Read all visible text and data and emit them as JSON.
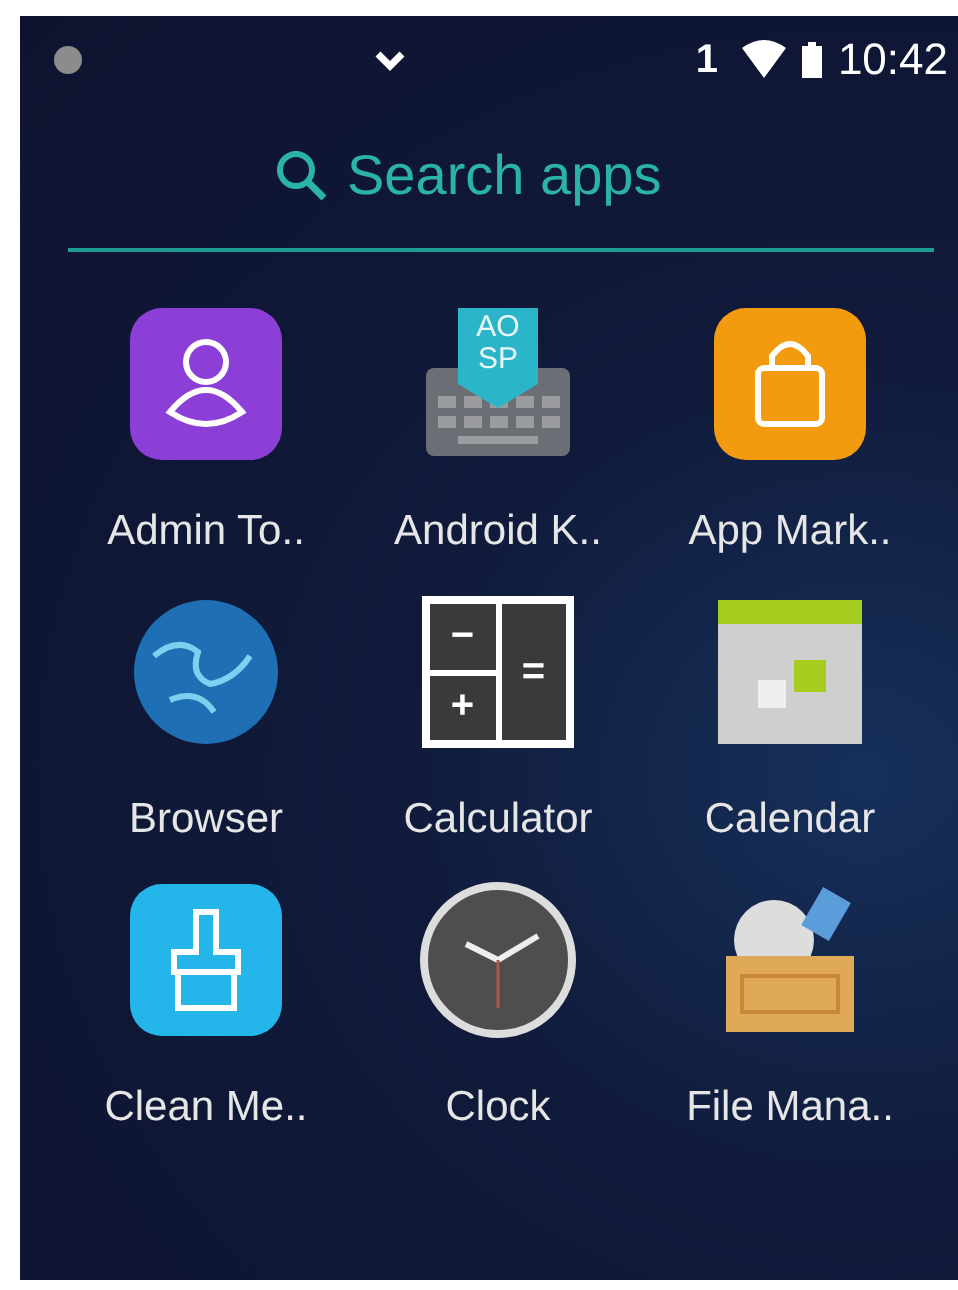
{
  "status_bar": {
    "notification_count": "1",
    "time": "10:42"
  },
  "search": {
    "placeholder": "Search apps"
  },
  "apps": [
    {
      "kind": "admin",
      "label": "Admin To.."
    },
    {
      "kind": "keyboard",
      "label": "Android K..",
      "icon_text": [
        "AO",
        "SP"
      ]
    },
    {
      "kind": "market",
      "label": "App Mark.."
    },
    {
      "kind": "browser",
      "label": "Browser"
    },
    {
      "kind": "calculator",
      "label": "Calculator",
      "icon_text": [
        "−",
        "+",
        "="
      ]
    },
    {
      "kind": "calendar",
      "label": "Calendar"
    },
    {
      "kind": "cleaner",
      "label": "Clean Me.."
    },
    {
      "kind": "clock",
      "label": "Clock"
    },
    {
      "kind": "files",
      "label": "File Mana.."
    }
  ]
}
